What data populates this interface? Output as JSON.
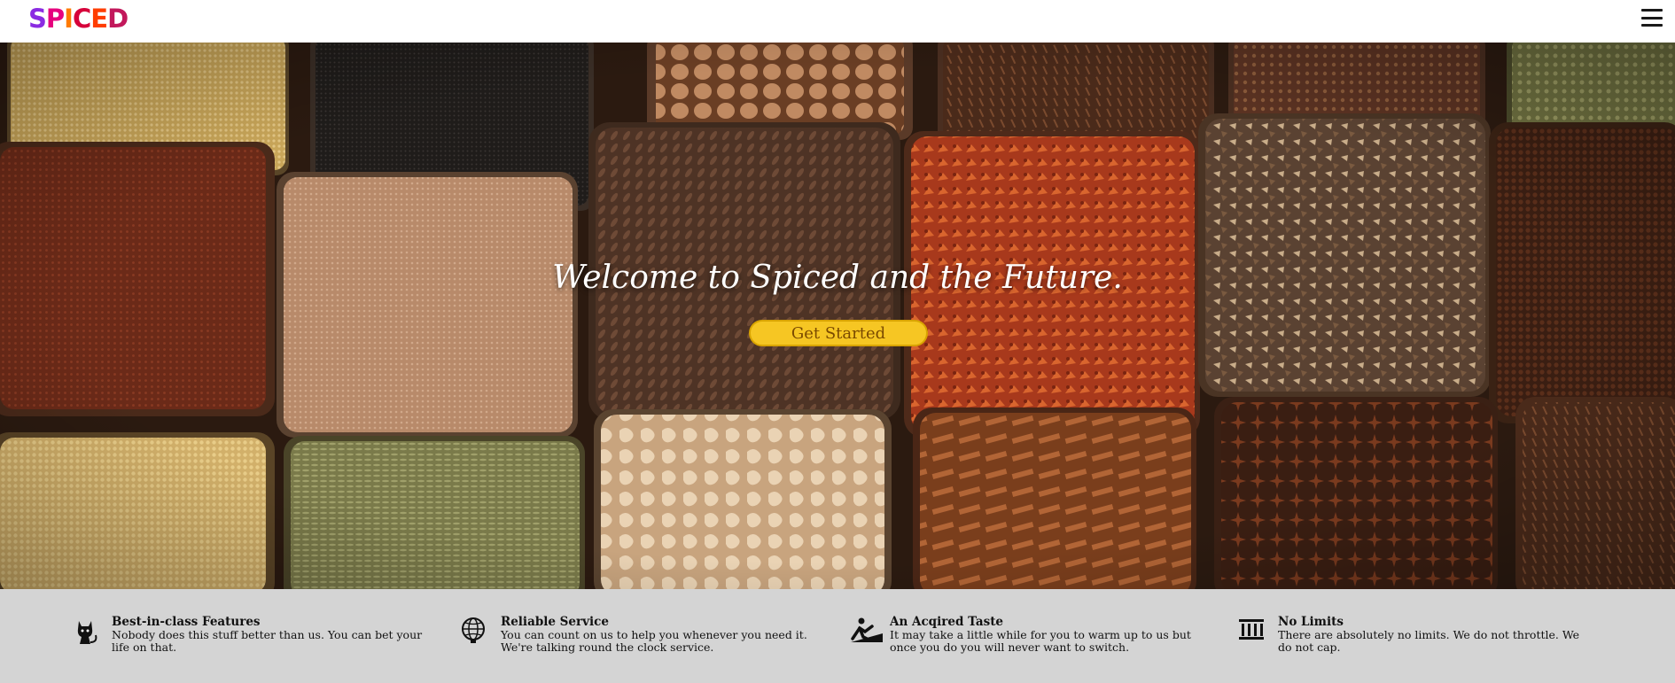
{
  "header": {
    "logo_letters": [
      {
        "char": "S",
        "color": "#8a2be2"
      },
      {
        "char": "P",
        "color": "#e6007e"
      },
      {
        "char": "I",
        "color": "#ff7a00"
      },
      {
        "char": "C",
        "color": "#d6003a"
      },
      {
        "char": "E",
        "color": "#ff3d00"
      },
      {
        "char": "D",
        "color": "#c2185b"
      }
    ],
    "menu_icon": "hamburger-icon"
  },
  "hero": {
    "title": "Welcome to Spiced and the Future.",
    "cta_label": "Get Started",
    "background": "spice-market-baskets"
  },
  "features": [
    {
      "icon": "cat-icon",
      "title": "Best-in-class Features",
      "body": "Nobody does this stuff better than us. You can bet your life on that."
    },
    {
      "icon": "globe-icon",
      "title": "Reliable Service",
      "body": "You can count on us to help you whenever you need it. We're talking round the clock service."
    },
    {
      "icon": "climbing-icon",
      "title": "An Acqired Taste",
      "body": "It may take a little while for you to warm up to us but once you do you will never want to switch."
    },
    {
      "icon": "bars-icon",
      "title": "No Limits",
      "body": "There are absolutely no limits. We do not throttle. We do not cap."
    }
  ],
  "colors": {
    "cta_bg": "#f6c623",
    "features_bg": "#d4d4d4"
  }
}
